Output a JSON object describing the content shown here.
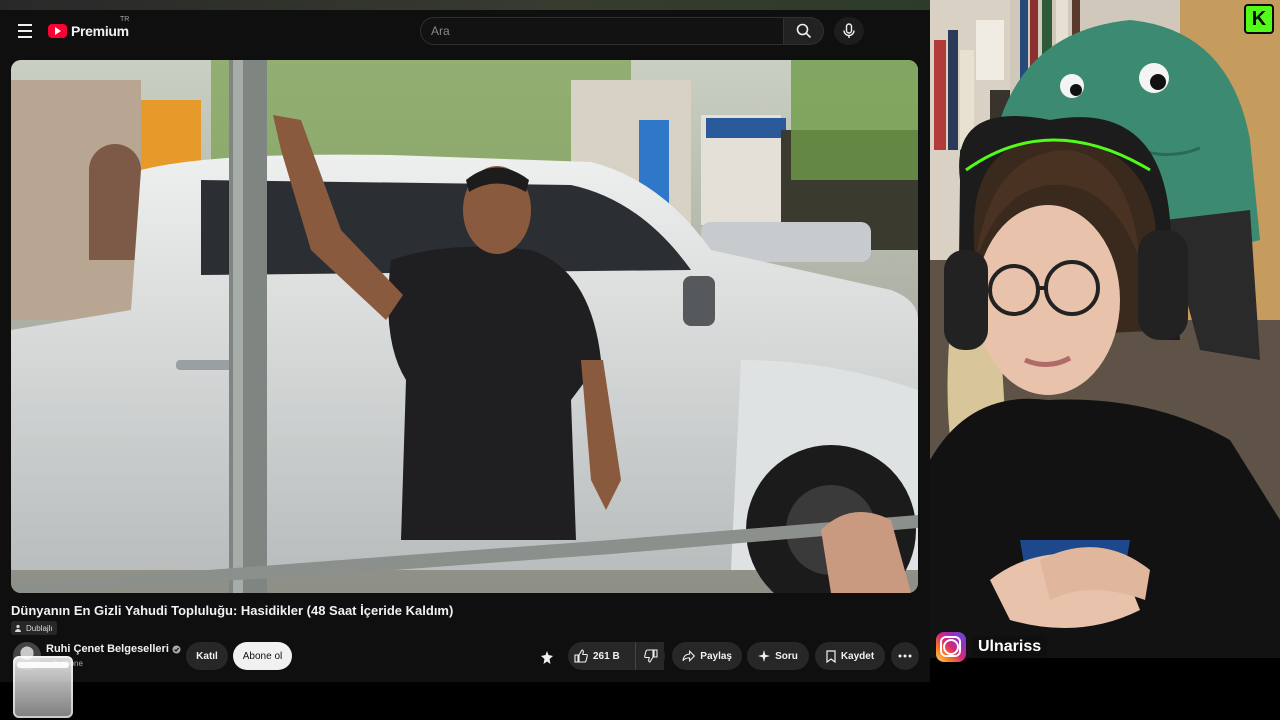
{
  "masthead": {
    "logo_text": "Premium",
    "country_code": "TR",
    "search_placeholder": "Ara"
  },
  "video": {
    "title": "Dünyanın En Gizli Yahudi Topluluğu: Hasidikler (48 Saat İçeride Kaldım)",
    "dub_badge": "Dublajlı"
  },
  "channel": {
    "name": "Ruhi Çenet Belgeselleri",
    "subscribers": "…h abone",
    "join_label": "Katıl",
    "subscribe_label": "Abone ol"
  },
  "actions": {
    "like_count": "261 B",
    "share_label": "Paylaş",
    "ask_label": "Soru",
    "save_label": "Kaydet"
  },
  "stream": {
    "kick_letter": "K",
    "instagram_handle": "Ulnariss"
  },
  "colors": {
    "youtube_red": "#ff0033",
    "background": "#0f0f0f",
    "chip": "#272727",
    "kick_green": "#53fc18"
  }
}
